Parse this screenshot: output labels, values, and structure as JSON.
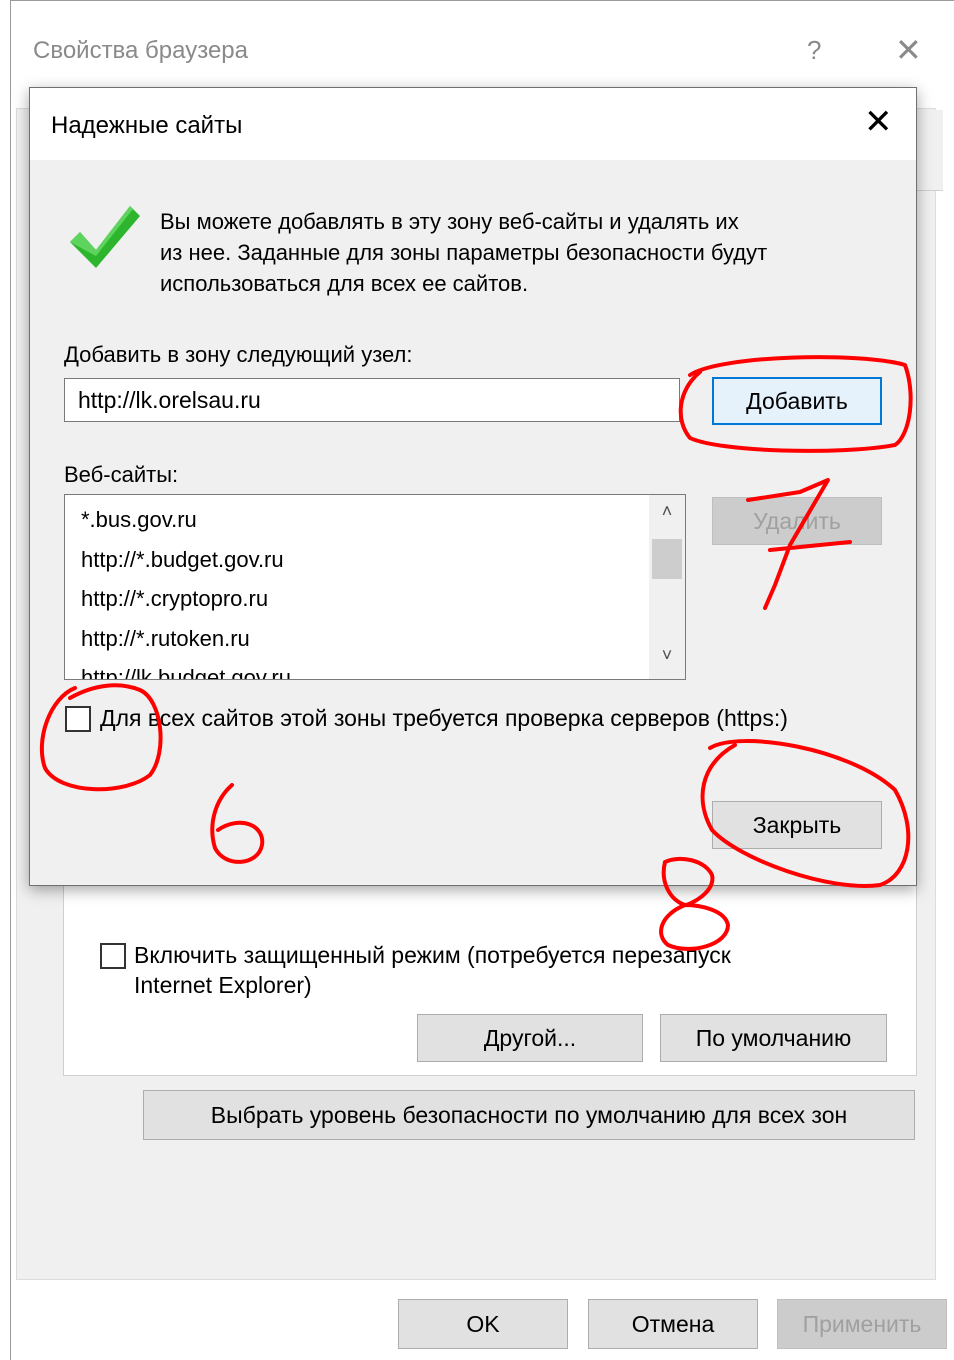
{
  "outer_window": {
    "title": "Свойства браузера",
    "help_glyph": "?",
    "close_glyph": "✕",
    "protected_mode_label_line1": "Включить защищенный режим (потребуется перезапуск",
    "protected_mode_label_line2": "Internet Explorer)",
    "custom_button": "Другой...",
    "default_button": "По умолчанию",
    "reset_all_zones_button": "Выбрать уровень безопасности по умолчанию для всех зон",
    "ok_button": "OK",
    "cancel_button": "Отмена",
    "apply_button": "Применить"
  },
  "dialog": {
    "title": "Надежные сайты",
    "close_glyph": "✕",
    "info_line1": "Вы можете добавлять в эту зону  веб-сайты и удалять их",
    "info_line2": "из нее. Заданные для зоны параметры безопасности будут",
    "info_line3": "использоваться для всех ее сайтов.",
    "add_label": "Добавить в зону следующий узел:",
    "add_input_value": "http://lk.orelsau.ru",
    "add_button": "Добавить",
    "websites_label": "Веб-сайты:",
    "websites": [
      "*.bus.gov.ru",
      "http://*.budget.gov.ru",
      "http://*.cryptopro.ru",
      "http://*.rutoken.ru",
      "http://lk.budget.gov.ru"
    ],
    "remove_button": "Удалить",
    "https_label": "Для всех сайтов этой зоны требуется проверка серверов (https:)",
    "close_button": "Закрыть"
  },
  "annotations": {
    "num_6": "6",
    "num_7": "7",
    "num_8": "8",
    "color": "#ff0000"
  },
  "icons": {
    "checkmark": "green-check-icon",
    "scroll_up": "chevron-up-icon",
    "scroll_down": "chevron-down-icon"
  }
}
